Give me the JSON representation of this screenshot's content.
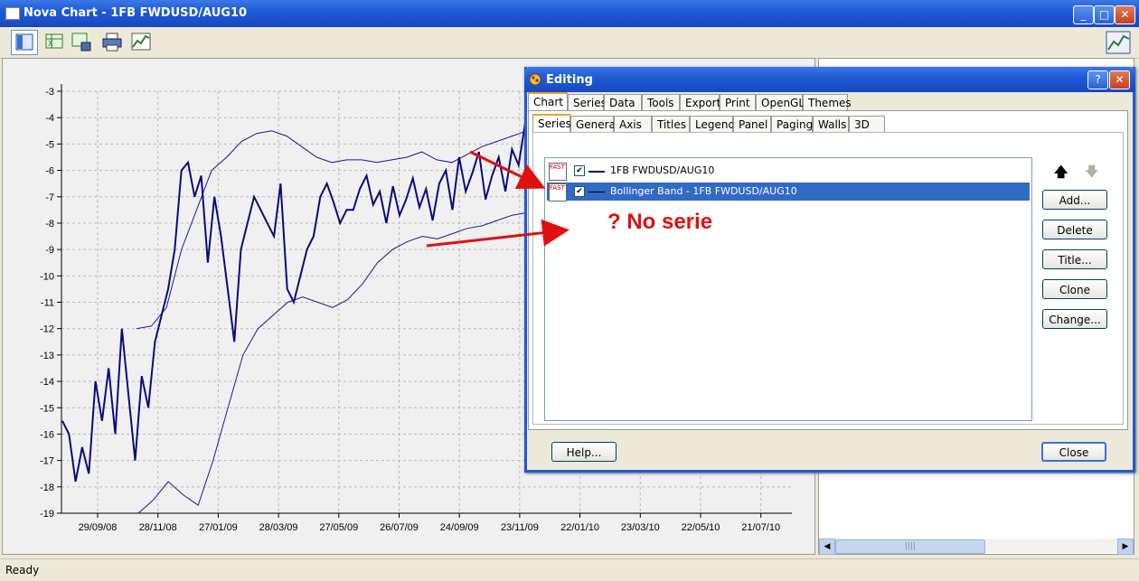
{
  "window": {
    "title": "Nova Chart - 1FB FWDUSD/AUG10"
  },
  "status": {
    "text": "Ready"
  },
  "chart": {
    "y_ticks": [
      "-3",
      "-4",
      "-5",
      "-6",
      "-7",
      "-8",
      "-9",
      "-10",
      "-11",
      "-12",
      "-13",
      "-14",
      "-15",
      "-16",
      "-17",
      "-18",
      "-19"
    ],
    "x_ticks": [
      "29/09/08",
      "28/11/08",
      "27/01/09",
      "28/03/09",
      "27/05/09",
      "26/07/09",
      "24/09/09",
      "23/11/09",
      "22/01/10",
      "23/03/10",
      "22/05/10",
      "21/07/10"
    ],
    "series_color": "#0b0b7a"
  },
  "chart_data": {
    "type": "line",
    "ylim": [
      -19,
      -3
    ],
    "x_range": [
      "2008-08-31",
      "2010-08-20"
    ],
    "series": [
      {
        "name": "1FB FWDUSD/AUG10",
        "values": [
          -15.5,
          -16,
          -17.8,
          -16.5,
          -17.5,
          -14,
          -15.5,
          -13.5,
          -16,
          -12,
          -14.5,
          -17,
          -13.8,
          -15,
          -12.5,
          -11.5,
          -10.5,
          -9,
          -6,
          -5.7,
          -7,
          -6.2,
          -9.5,
          -7,
          -8.5,
          -10.5,
          -12.5,
          -9,
          -8,
          -7,
          -7.5,
          -8,
          -8.5,
          -6.5,
          -10.5,
          -11,
          -10,
          -9,
          -8.5,
          -7,
          -6.5,
          -7.2,
          -8,
          -7.5,
          -7.5,
          -6.7,
          -6.2,
          -7.3,
          -6.8,
          -8,
          -6.6,
          -7.7,
          -7.1,
          -6.3,
          -7.4,
          -6.7,
          -7.9,
          -6.5,
          -6,
          -7.5,
          -5.5,
          -6.8,
          -6.1,
          -5.3,
          -7.1,
          -6.2,
          -5.5,
          -6.8,
          -5.2,
          -5.8,
          -4.2
        ]
      },
      {
        "name": "Bollinger Band - 1FB FWDUSD/AUG10",
        "upper": [
          -12,
          -11.9,
          -11.2,
          -9,
          -7.5,
          -6,
          -5.5,
          -4.9,
          -4.6,
          -4.5,
          -4.7,
          -5.1,
          -5.5,
          -5.7,
          -5.6,
          -5.6,
          -5.7,
          -5.6,
          -5.5,
          -5.3,
          -5.6,
          -5.7,
          -5.4,
          -5.1,
          -4.9,
          -4.7,
          -4.5
        ],
        "lower": [
          -19,
          -18.5,
          -17.8,
          -18.3,
          -18.7,
          -17,
          -15,
          -13,
          -12,
          -11.5,
          -11,
          -10.8,
          -11,
          -11.2,
          -10.9,
          -10.3,
          -9.5,
          -9,
          -8.7,
          -8.5,
          -8.6,
          -8.4,
          -8.2,
          -8.1,
          -7.9,
          -7.7,
          -7.6
        ]
      }
    ]
  },
  "dialog": {
    "title": "Editing",
    "tabs": [
      "Chart",
      "Series",
      "Data",
      "Tools",
      "Export",
      "Print",
      "OpenGL",
      "Themes"
    ],
    "subtabs": [
      "Series",
      "General",
      "Axis",
      "Titles",
      "Legend",
      "Panel",
      "Paging",
      "Walls",
      "3D"
    ],
    "series_list": [
      {
        "label": "1FB FWDUSD/AUG10",
        "checked": "✔"
      },
      {
        "label": "Bollinger Band - 1FB FWDUSD/AUG10",
        "checked": "✔"
      }
    ],
    "buttons": {
      "add": "Add...",
      "delete": "Delete",
      "title": "Title...",
      "clone": "Clone",
      "change": "Change...",
      "help": "Help...",
      "close": "Close"
    }
  },
  "annotation": {
    "text": "? No serie"
  },
  "hscroll": {
    "grip": "||||"
  }
}
